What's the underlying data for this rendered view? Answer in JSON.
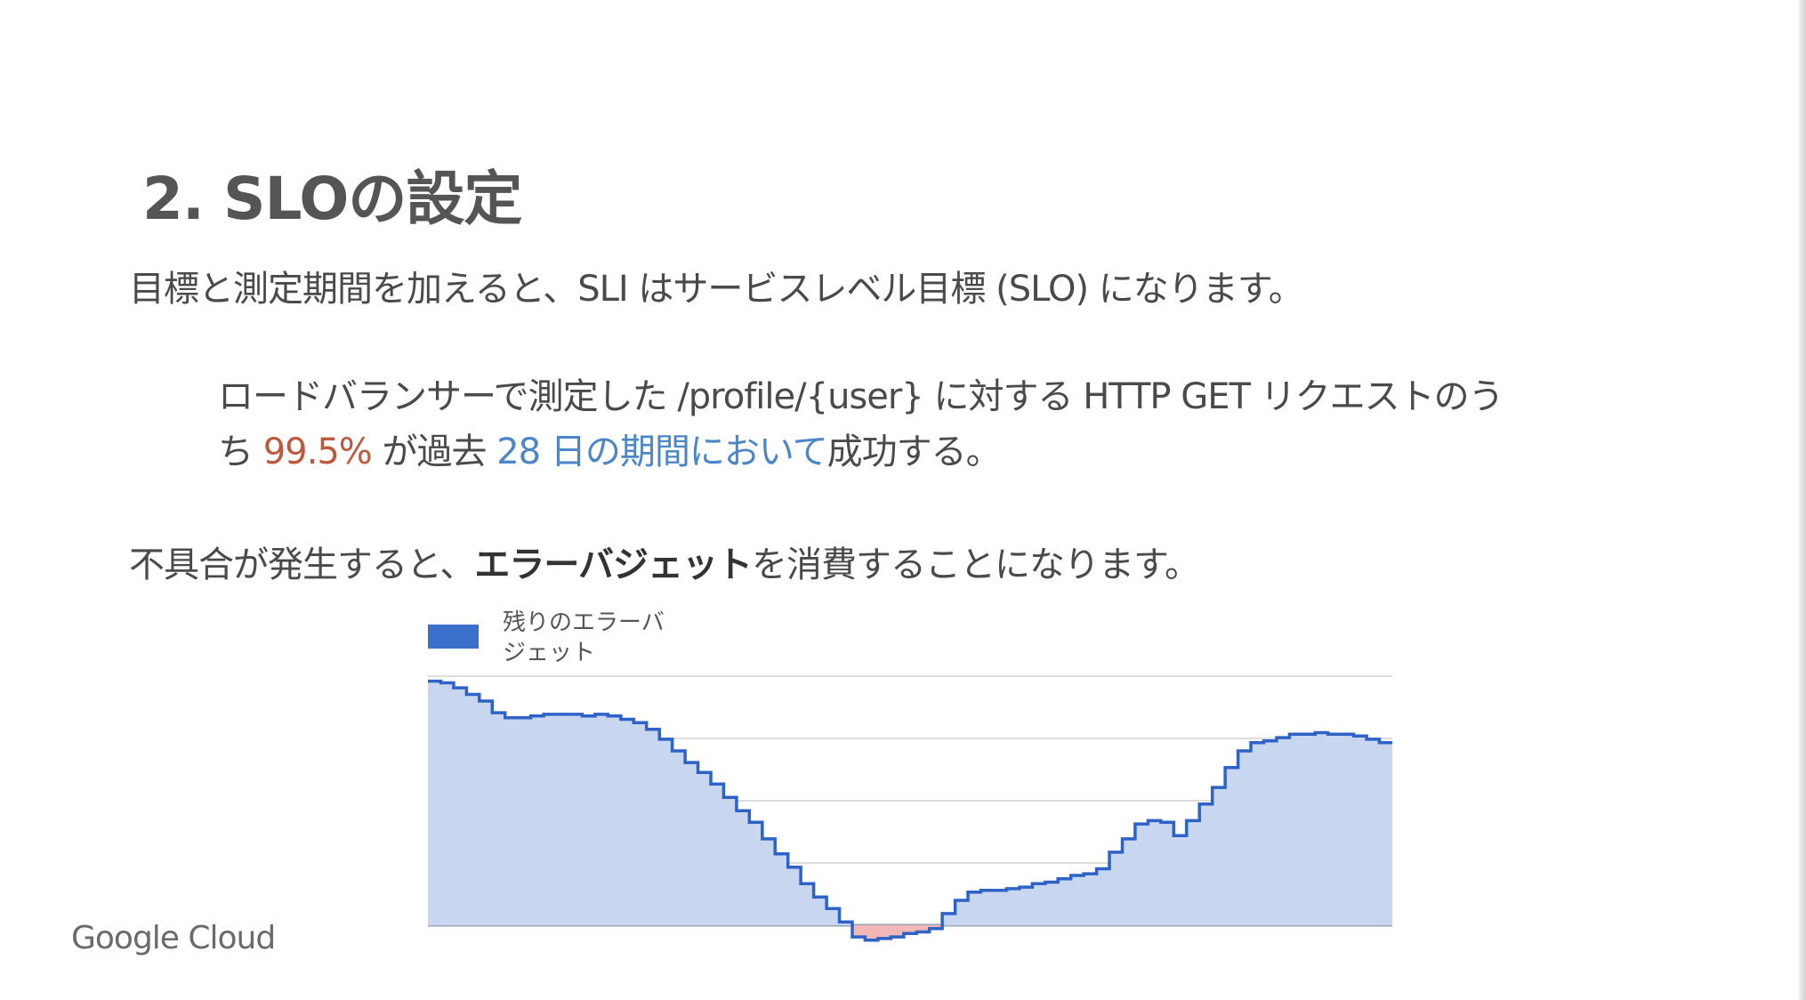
{
  "slide": {
    "title": "2. SLOの設定",
    "subtitle": "目標と測定期間を加えると、SLI はサービスレベル目標 (SLO) になります。",
    "slo": {
      "line1": "ロードバランサーで測定した /profile/{user} に対する HTTP GET リクエストのう",
      "line2_prefix": "ち ",
      "target": "99.5%",
      "line2_mid": " が過去 ",
      "period": "28 日の期間において",
      "line2_suffix": "成功する。"
    },
    "error_line": {
      "prefix": "不具合が発生すると、",
      "strong": "エラーバジェット",
      "suffix": "を消費することになります。"
    },
    "footer": "Google Cloud"
  },
  "colors": {
    "title": "#555555",
    "text": "#4a4a4a",
    "target_red": "#c0583e",
    "period_blue": "#4a86c8",
    "series_line": "#2d63c8",
    "series_fill": "#c8d6ef",
    "negative_fill": "#f2b8b8",
    "gridline": "#dddddd"
  },
  "chart_data": {
    "type": "area",
    "legend": [
      "残りのエラーバジェット"
    ],
    "legend_placement": "top-left",
    "grid": true,
    "gridlines": 5,
    "ylim": [
      -0.15,
      1.5
    ],
    "series": [
      {
        "name": "残りのエラーバジェット",
        "step": true,
        "values": [
          1.47,
          1.46,
          1.43,
          1.39,
          1.35,
          1.28,
          1.25,
          1.25,
          1.26,
          1.27,
          1.27,
          1.27,
          1.26,
          1.27,
          1.26,
          1.24,
          1.22,
          1.18,
          1.12,
          1.05,
          0.98,
          0.92,
          0.85,
          0.77,
          0.69,
          0.62,
          0.52,
          0.43,
          0.35,
          0.25,
          0.17,
          0.1,
          0.02,
          -0.07,
          -0.09,
          -0.08,
          -0.07,
          -0.05,
          -0.04,
          -0.02,
          0.07,
          0.15,
          0.2,
          0.21,
          0.21,
          0.22,
          0.23,
          0.25,
          0.26,
          0.28,
          0.3,
          0.31,
          0.34,
          0.44,
          0.52,
          0.61,
          0.63,
          0.62,
          0.54,
          0.63,
          0.73,
          0.83,
          0.95,
          1.05,
          1.1,
          1.11,
          1.13,
          1.15,
          1.15,
          1.16,
          1.15,
          1.15,
          1.14,
          1.12,
          1.1
        ]
      }
    ]
  }
}
